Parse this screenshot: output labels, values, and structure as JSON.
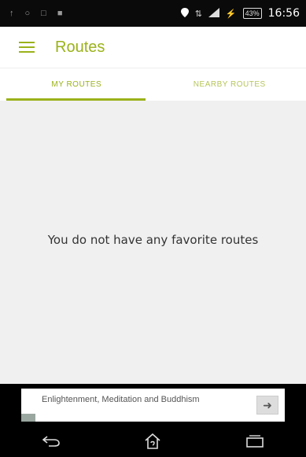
{
  "status_bar": {
    "left_icons": [
      "notification-icon",
      "gps-icon",
      "screenshot-icon",
      "media-icon"
    ],
    "right_icons": [
      "location-pin-icon",
      "mobile-data-icon",
      "signal-icon",
      "charging-icon"
    ],
    "battery": "43%",
    "time": "16:56"
  },
  "app_bar": {
    "title": "Routes",
    "accent": "#9bb21a"
  },
  "tabs": [
    {
      "label": "MY ROUTES",
      "active": true
    },
    {
      "label": "NEARBY ROUTES",
      "active": false
    }
  ],
  "content": {
    "empty_message": "You do not have any favorite routes"
  },
  "ad": {
    "text": "Enlightenment, Meditation and Buddhism",
    "action_icon": "arrow-right-icon"
  },
  "nav": {
    "icons": [
      "back-icon",
      "home-icon",
      "recents-icon"
    ]
  }
}
